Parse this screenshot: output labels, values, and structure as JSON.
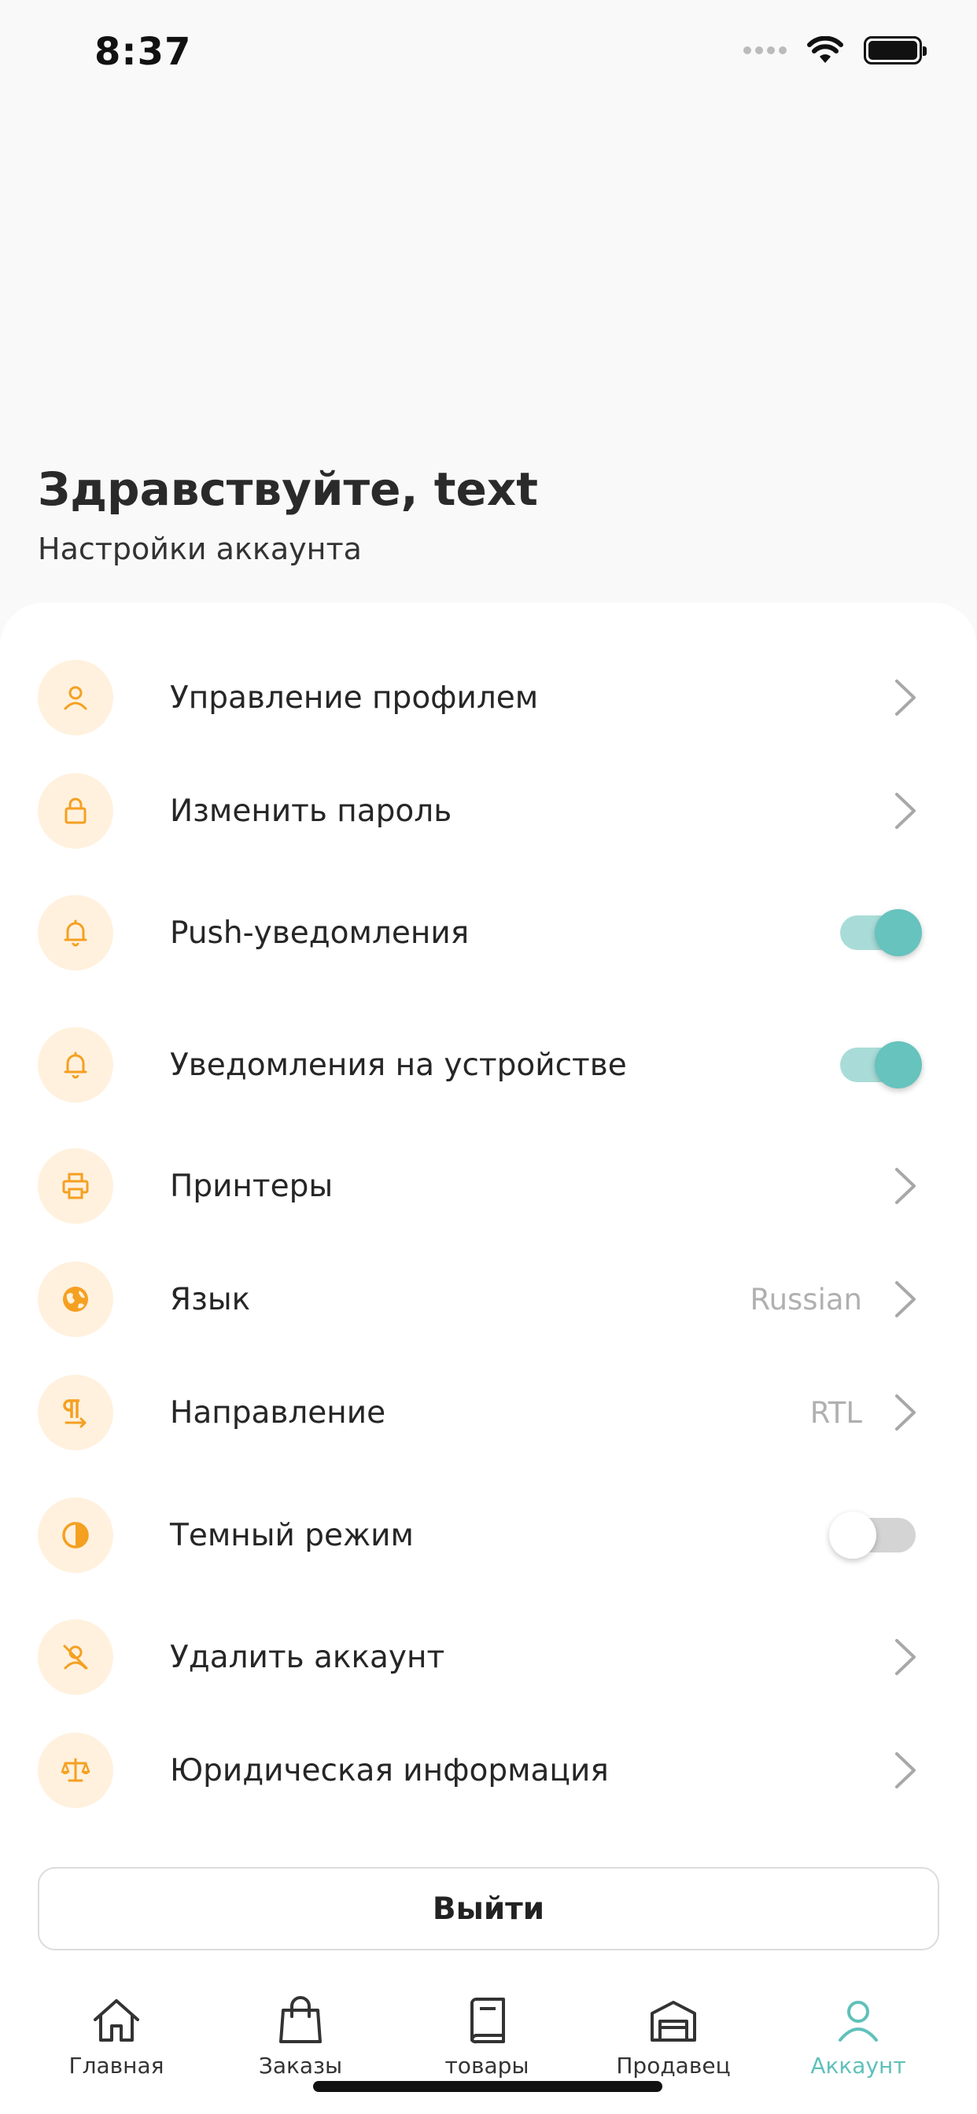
{
  "status_bar": {
    "time": "8:37"
  },
  "header": {
    "greeting": "Здравствуйте, text",
    "subtitle": "Настройки аккаунта"
  },
  "colors": {
    "accent": "#66c3bd",
    "icon": "#f5a021",
    "icon_bg": "#fff1de"
  },
  "menu": [
    {
      "label": "Управление профилем",
      "icon": "user-icon",
      "control": "chevron"
    },
    {
      "label": "Изменить пароль",
      "icon": "lock-icon",
      "control": "chevron"
    },
    {
      "label": "Push-уведомления",
      "icon": "bell-icon",
      "control": "toggle",
      "enabled": true
    },
    {
      "label": "Уведомления на устройстве",
      "icon": "bell-icon",
      "control": "toggle",
      "enabled": true
    },
    {
      "label": "Принтеры",
      "icon": "printer-icon",
      "control": "chevron"
    },
    {
      "label": "Язык",
      "icon": "globe-icon",
      "control": "chevron",
      "value": "Russian"
    },
    {
      "label": "Направление",
      "icon": "text-direction-icon",
      "control": "chevron",
      "value": "RTL"
    },
    {
      "label": "Темный режим",
      "icon": "contrast-icon",
      "control": "toggle",
      "enabled": false
    },
    {
      "label": "Удалить аккаунт",
      "icon": "user-remove-icon",
      "control": "chevron"
    },
    {
      "label": "Юридическая информация",
      "icon": "scales-icon",
      "control": "chevron"
    }
  ],
  "logout_label": "Выйти",
  "tabs": [
    {
      "label": "Главная",
      "icon": "home-icon",
      "active": false
    },
    {
      "label": "Заказы",
      "icon": "shopping-bag-icon",
      "active": false
    },
    {
      "label": "товары",
      "icon": "book-icon",
      "active": false
    },
    {
      "label": "Продавец",
      "icon": "store-icon",
      "active": false
    },
    {
      "label": "Аккаунт",
      "icon": "account-icon",
      "active": true
    }
  ]
}
